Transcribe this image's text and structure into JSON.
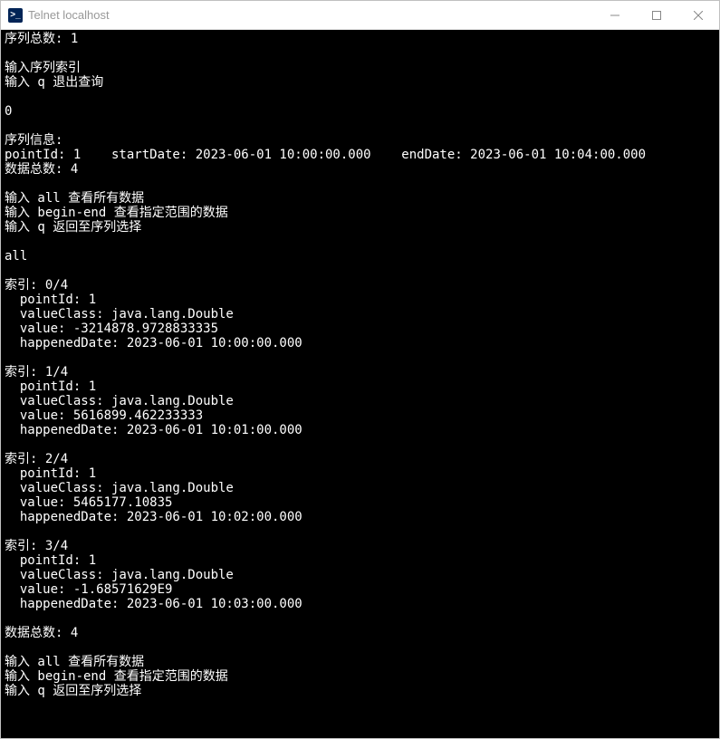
{
  "window": {
    "title": "Telnet localhost",
    "icon_glyph": ">_"
  },
  "terminal": {
    "lines": [
      "序列总数: 1",
      "",
      "输入序列索引",
      "输入 q 退出查询",
      "",
      "0",
      "",
      "序列信息:",
      "pointId: 1    startDate: 2023-06-01 10:00:00.000    endDate: 2023-06-01 10:04:00.000",
      "数据总数: 4",
      "",
      "输入 all 查看所有数据",
      "输入 begin-end 查看指定范围的数据",
      "输入 q 返回至序列选择",
      "",
      "all",
      "",
      "索引: 0/4",
      "  pointId: 1",
      "  valueClass: java.lang.Double",
      "  value: -3214878.9728833335",
      "  happenedDate: 2023-06-01 10:00:00.000",
      "",
      "索引: 1/4",
      "  pointId: 1",
      "  valueClass: java.lang.Double",
      "  value: 5616899.462233333",
      "  happenedDate: 2023-06-01 10:01:00.000",
      "",
      "索引: 2/4",
      "  pointId: 1",
      "  valueClass: java.lang.Double",
      "  value: 5465177.10835",
      "  happenedDate: 2023-06-01 10:02:00.000",
      "",
      "索引: 3/4",
      "  pointId: 1",
      "  valueClass: java.lang.Double",
      "  value: -1.68571629E9",
      "  happenedDate: 2023-06-01 10:03:00.000",
      "",
      "数据总数: 4",
      "",
      "输入 all 查看所有数据",
      "输入 begin-end 查看指定范围的数据",
      "输入 q 返回至序列选择",
      ""
    ]
  }
}
